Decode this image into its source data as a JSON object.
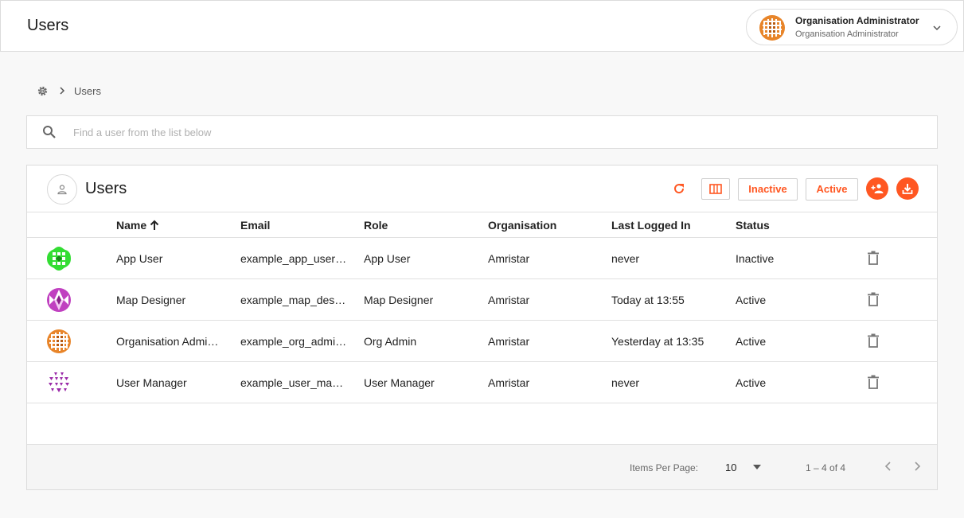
{
  "header": {
    "title": "Users",
    "account": {
      "name": "Organisation Administrator",
      "role": "Organisation Administrator",
      "avatar_icon": "orange-grid-avatar",
      "menu_icon": "chevron-down-icon"
    }
  },
  "breadcrumb": {
    "root_icon": "gear-icon",
    "items": [
      "Users"
    ]
  },
  "search": {
    "placeholder": "Find a user from the list below",
    "value": ""
  },
  "card": {
    "title": "Users",
    "toolbar": {
      "refresh_icon": "refresh-icon",
      "columns_icon": "view-column-icon",
      "inactive_label": "Inactive",
      "active_label": "Active",
      "add_user_icon": "person-add-icon",
      "download_icon": "download-icon"
    },
    "columns": [
      "Name",
      "Email",
      "Role",
      "Organisation",
      "Last Logged In",
      "Status"
    ],
    "sort": {
      "column": "Name",
      "direction": "ascending"
    },
    "rows": [
      {
        "name": "App User",
        "email": "example_app_user@example.com",
        "role": "App User",
        "organisation": "Amristar",
        "last_logged_in": "never",
        "status": "Inactive",
        "avatar_color": "#33dd33"
      },
      {
        "name": "Map Designer",
        "email": "example_map_designer@example.com",
        "role": "Map Designer",
        "organisation": "Amristar",
        "last_logged_in": "Today at 13:55",
        "status": "Active",
        "avatar_color": "#c040c0"
      },
      {
        "name": "Organisation Administrator",
        "email": "example_org_admin@example.com",
        "role": "Org Admin",
        "organisation": "Amristar",
        "last_logged_in": "Yesterday at 13:35",
        "status": "Active",
        "avatar_color": "#e8852a"
      },
      {
        "name": "User Manager",
        "email": "example_user_manager@example.com",
        "role": "User Manager",
        "organisation": "Amristar",
        "last_logged_in": "never",
        "status": "Active",
        "avatar_color": "#9a2aa8"
      }
    ],
    "footer": {
      "items_per_page_label": "Items Per Page:",
      "items_per_page": "10",
      "range": "1 – 4 of 4"
    }
  },
  "colors": {
    "accent": "#ff5722",
    "border": "#dcdcdc",
    "background": "#f8f8f8"
  }
}
